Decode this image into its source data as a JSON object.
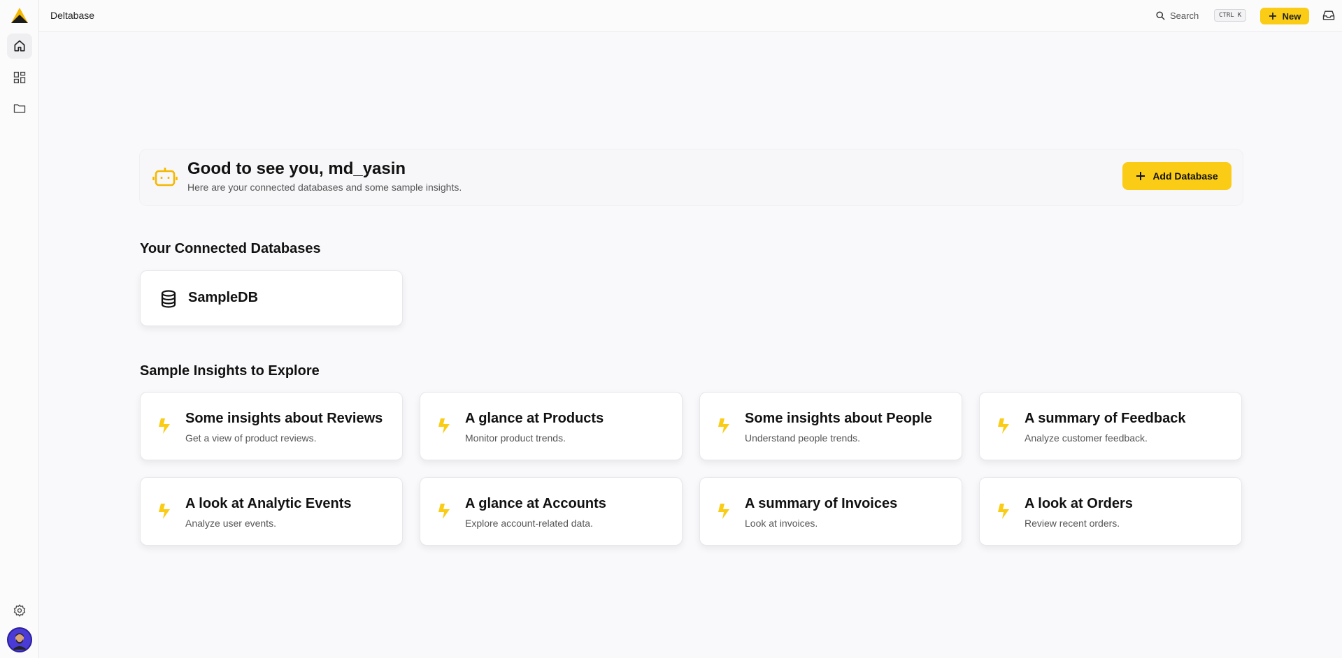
{
  "app": {
    "title": "Deltabase"
  },
  "header": {
    "search_label": "Search",
    "shortcut_ctrl": "CTRL",
    "shortcut_key": "K",
    "new_label": "New"
  },
  "welcome": {
    "title": "Good to see you, md_yasin",
    "subtitle": "Here are your connected databases and some sample insights.",
    "add_database_label": "Add Database"
  },
  "databases": {
    "section_title": "Your Connected Databases",
    "items": [
      {
        "name": "SampleDB"
      }
    ]
  },
  "insights": {
    "section_title": "Sample Insights to Explore",
    "items": [
      {
        "title": "Some insights about Reviews",
        "desc": "Get a view of product reviews."
      },
      {
        "title": "A glance at Products",
        "desc": "Monitor product trends."
      },
      {
        "title": "Some insights about People",
        "desc": "Understand people trends."
      },
      {
        "title": "A summary of Feedback",
        "desc": "Analyze customer feedback."
      },
      {
        "title": "A look at Analytic Events",
        "desc": "Analyze user events."
      },
      {
        "title": "A glance at Accounts",
        "desc": "Explore account-related data."
      },
      {
        "title": "A summary of Invoices",
        "desc": "Look at invoices."
      },
      {
        "title": "A look at Orders",
        "desc": "Review recent orders."
      }
    ]
  },
  "colors": {
    "accent": "#facc15",
    "background": "#f9f9fb"
  },
  "icons": {
    "sidebar": [
      "home-icon",
      "dashboard-icon",
      "folder-icon",
      "settings-icon"
    ],
    "header": [
      "search-icon",
      "plus-icon",
      "inbox-icon"
    ]
  }
}
